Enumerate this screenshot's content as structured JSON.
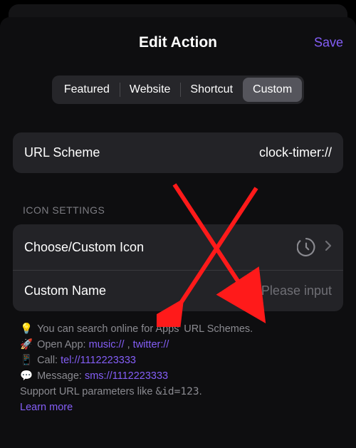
{
  "header": {
    "title": "Edit Action",
    "save_label": "Save"
  },
  "tabs": {
    "featured": "Featured",
    "website": "Website",
    "shortcut": "Shortcut",
    "custom": "Custom"
  },
  "url_scheme": {
    "label": "URL Scheme",
    "value": "clock-timer://"
  },
  "icon_settings": {
    "header": "ICON SETTINGS",
    "choose_label": "Choose/Custom Icon",
    "custom_name_label": "Custom Name",
    "custom_name_placeholder": "Please input"
  },
  "tips": {
    "bulb": "💡",
    "rocket": "🚀",
    "keypad": "📱",
    "speech": "💬",
    "line1": "You can search online for Apps' URL Schemes.",
    "line2_prefix": "Open App: ",
    "link_music": "music://",
    "sep": " ,  ",
    "link_twitter": "twitter://",
    "line3_prefix": "Call: ",
    "link_tel": "tel://1112223333",
    "line4_prefix": "Message: ",
    "link_sms": "sms://1112223333",
    "line5_a": "Support URL parameters like ",
    "line5_code": "&id=123",
    "line5_b": ".",
    "learn_more": "Learn more"
  }
}
